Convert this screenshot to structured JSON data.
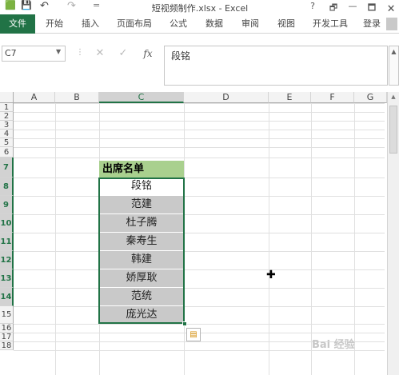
{
  "window": {
    "title": "短视频制作.xlsx - Excel",
    "quick_access": [
      "💾",
      "↶",
      "↷",
      "="
    ],
    "controls": [
      "?",
      "🗗",
      "—",
      "🗖",
      "🗙"
    ]
  },
  "ribbon": {
    "file_tab": "文件",
    "tabs": [
      "开始",
      "插入",
      "页面布局",
      "公式",
      "数据",
      "审阅",
      "视图",
      "开发工具"
    ],
    "account": "登录"
  },
  "formula_bar": {
    "name_box": "C7",
    "cancel_icon": "✕",
    "enter_icon": "✓",
    "fx_label": "fx",
    "value": "段铭"
  },
  "sheet": {
    "columns": [
      "A",
      "B",
      "C",
      "D",
      "E",
      "F",
      "G"
    ],
    "rows": [
      "1",
      "2",
      "3",
      "4",
      "5",
      "6",
      "7",
      "8",
      "9",
      "10",
      "11",
      "12",
      "13",
      "14",
      "15",
      "16",
      "17",
      "18"
    ],
    "header_cell": "出席名单",
    "names": [
      "段铭",
      "范建",
      "杜子腾",
      "秦寿生",
      "韩建",
      "娇厚耿",
      "范统",
      "庞光达"
    ],
    "selected_cell": "C7",
    "accent_color": "#217346",
    "header_fill": "#a9d08e",
    "cell_fill": "#c9c9c9"
  },
  "watermark": "Bai 经验"
}
